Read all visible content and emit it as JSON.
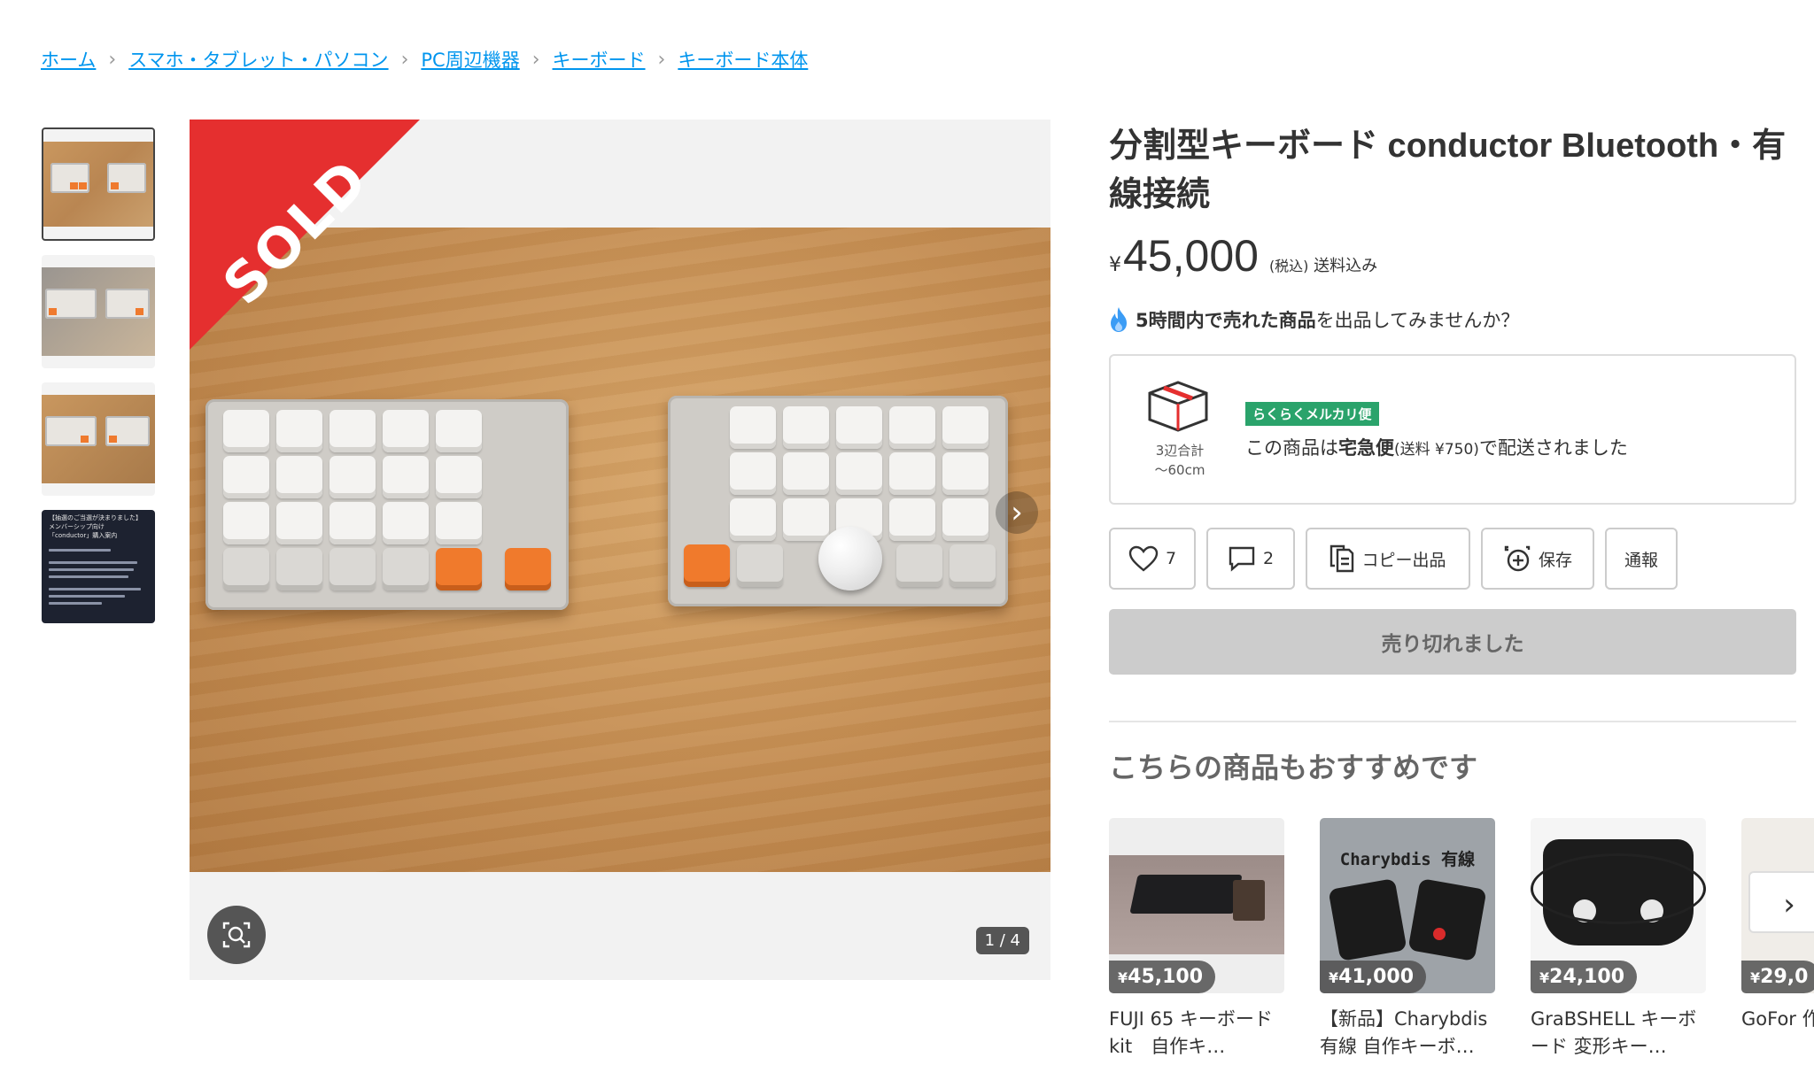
{
  "breadcrumb": [
    "ホーム",
    "スマホ・タブレット・パソコン",
    "PC周辺機器",
    "キーボード",
    "キーボード本体"
  ],
  "thumbnail_doc": {
    "line1": "【抽選のご当選が決まりました】",
    "line2": "メンバーシップ向け",
    "line3": "「conductor」購入案内"
  },
  "main_image": {
    "sold_label": "SOLD",
    "counter": "1 / 4"
  },
  "product": {
    "title": "分割型キーボード conductor Bluetooth・有線接続",
    "currency": "¥",
    "price": "45,000",
    "tax_note": "(税込)",
    "shipping_note": "送料込み"
  },
  "notice": {
    "bold": "5時間内で売れた商品",
    "rest": "を出品してみませんか？"
  },
  "shipping": {
    "size_line1": "3辺合計",
    "size_line2": "〜60cm",
    "badge": "らくらくメルカリ便",
    "text_pre": "この商品は",
    "text_bold": "宅急便",
    "text_fee": "(送料 ¥750)",
    "text_post": "で配送されました"
  },
  "actions": {
    "like_count": "7",
    "comment_count": "2",
    "copy_label": "コピー出品",
    "save_label": "保存",
    "report_label": "通報"
  },
  "soldout_label": "売り切れました",
  "recommend": {
    "title": "こちらの商品もおすすめです",
    "items": [
      {
        "price": "45,100",
        "name": "FUJI 65 キーボード　kit　自作キ…"
      },
      {
        "price": "41,000",
        "name": "【新品】Charybdis 有線 自作キーボ…",
        "image_text": "Charybdis 有線"
      },
      {
        "price": "24,100",
        "name": "GraBSHELL キーボード 変形キー…"
      },
      {
        "price": "29,0",
        "name": "GoFor 作キー…"
      }
    ]
  },
  "colors": {
    "sold_red": "#e52f2f",
    "link_blue": "#0095ee",
    "badge_green": "#2aa36b",
    "flame_blue": "#3b9cf5"
  }
}
